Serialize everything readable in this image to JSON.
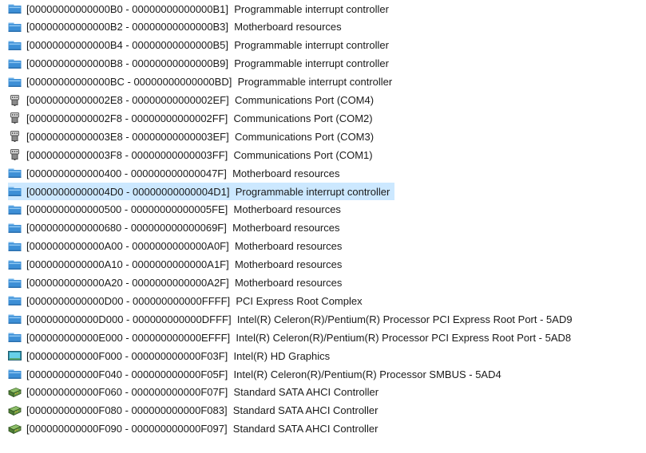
{
  "device_resources": {
    "rows": [
      {
        "range": "[00000000000000B0 - 00000000000000B1]",
        "device": "Programmable interrupt controller",
        "icon": "system-device-folder-icon"
      },
      {
        "range": "[00000000000000B2 - 00000000000000B3]",
        "device": "Motherboard resources",
        "icon": "system-device-folder-icon"
      },
      {
        "range": "[00000000000000B4 - 00000000000000B5]",
        "device": "Programmable interrupt controller",
        "icon": "system-device-folder-icon"
      },
      {
        "range": "[00000000000000B8 - 00000000000000B9]",
        "device": "Programmable interrupt controller",
        "icon": "system-device-folder-icon"
      },
      {
        "range": "[00000000000000BC - 00000000000000BD]",
        "device": "Programmable interrupt controller",
        "icon": "system-device-folder-icon"
      },
      {
        "range": "[00000000000002E8 - 00000000000002EF]",
        "device": "Communications Port (COM4)",
        "icon": "serial-port-icon"
      },
      {
        "range": "[00000000000002F8 - 00000000000002FF]",
        "device": "Communications Port (COM2)",
        "icon": "serial-port-icon"
      },
      {
        "range": "[00000000000003E8 - 00000000000003EF]",
        "device": "Communications Port (COM3)",
        "icon": "serial-port-icon"
      },
      {
        "range": "[00000000000003F8 - 00000000000003FF]",
        "device": "Communications Port (COM1)",
        "icon": "serial-port-icon"
      },
      {
        "range": "[0000000000000400 - 000000000000047F]",
        "device": "Motherboard resources",
        "icon": "system-device-folder-icon"
      },
      {
        "range": "[00000000000004D0 - 00000000000004D1]",
        "device": "Programmable interrupt controller",
        "icon": "system-device-folder-icon",
        "selected": true
      },
      {
        "range": "[0000000000000500 - 00000000000005FE]",
        "device": "Motherboard resources",
        "icon": "system-device-folder-icon"
      },
      {
        "range": "[0000000000000680 - 000000000000069F]",
        "device": "Motherboard resources",
        "icon": "system-device-folder-icon"
      },
      {
        "range": "[0000000000000A00 - 0000000000000A0F]",
        "device": "Motherboard resources",
        "icon": "system-device-folder-icon"
      },
      {
        "range": "[0000000000000A10 - 0000000000000A1F]",
        "device": "Motherboard resources",
        "icon": "system-device-folder-icon"
      },
      {
        "range": "[0000000000000A20 - 0000000000000A2F]",
        "device": "Motherboard resources",
        "icon": "system-device-folder-icon"
      },
      {
        "range": "[0000000000000D00 - 000000000000FFFF]",
        "device": "PCI Express Root Complex",
        "icon": "system-device-folder-icon"
      },
      {
        "range": "[000000000000D000 - 000000000000DFFF]",
        "device": "Intel(R) Celeron(R)/Pentium(R) Processor PCI Express Root Port - 5AD9",
        "icon": "system-device-folder-icon"
      },
      {
        "range": "[000000000000E000 - 000000000000EFFF]",
        "device": "Intel(R) Celeron(R)/Pentium(R) Processor PCI Express Root Port - 5AD8",
        "icon": "system-device-folder-icon"
      },
      {
        "range": "[000000000000F000 - 000000000000F03F]",
        "device": "Intel(R) HD Graphics",
        "icon": "display-adapter-icon"
      },
      {
        "range": "[000000000000F040 - 000000000000F05F]",
        "device": "Intel(R) Celeron(R)/Pentium(R) Processor SMBUS - 5AD4",
        "icon": "system-device-folder-icon"
      },
      {
        "range": "[000000000000F060 - 000000000000F07F]",
        "device": "Standard SATA AHCI Controller",
        "icon": "storage-controller-icon"
      },
      {
        "range": "[000000000000F080 - 000000000000F083]",
        "device": "Standard SATA AHCI Controller",
        "icon": "storage-controller-icon"
      },
      {
        "range": "[000000000000F090 - 000000000000F097]",
        "device": "Standard SATA AHCI Controller",
        "icon": "storage-controller-icon"
      }
    ]
  },
  "colors": {
    "selection": "#cce8ff",
    "folder_blue": "#3d8fd6",
    "text": "#1a1a1a"
  }
}
